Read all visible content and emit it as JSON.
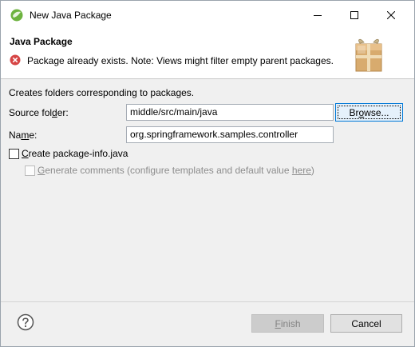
{
  "window": {
    "title": "New Java Package",
    "minimize_label": "minimize",
    "maximize_label": "maximize",
    "close_label": "close"
  },
  "banner": {
    "title": "Java Package",
    "message": "Package already exists. Note: Views might filter empty parent packages."
  },
  "form": {
    "description": "Creates folders corresponding to packages.",
    "source_label_pre": "Source fol",
    "source_label_mn": "d",
    "source_label_post": "er:",
    "source_value": "middle/src/main/java",
    "browse_pre": "Br",
    "browse_mn": "o",
    "browse_post": "wse...",
    "name_label_pre": "Na",
    "name_label_mn": "m",
    "name_label_post": "e:",
    "name_value": "org.springframework.samples.controller",
    "create_info_mn": "C",
    "create_info_post": "reate package-info.java",
    "create_info_checked": false,
    "generate_mn": "G",
    "generate_post": "enerate comments (configure templates and default value ",
    "generate_link": "here",
    "generate_close": ")",
    "generate_checked": false,
    "generate_enabled": false
  },
  "footer": {
    "finish_mn": "F",
    "finish_post": "inish",
    "finish_enabled": false,
    "cancel_label": "Cancel"
  },
  "colors": {
    "error": "#d64545",
    "focus_border": "#0078d7"
  }
}
